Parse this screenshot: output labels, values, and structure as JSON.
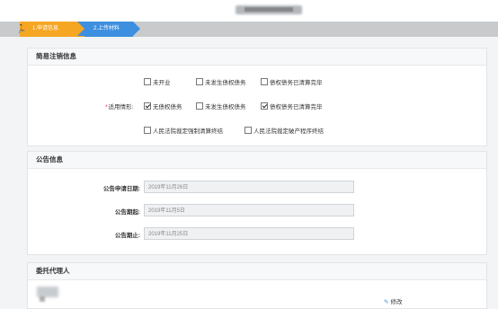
{
  "header": {
    "title_blurred": true
  },
  "steps": {
    "home_glyph": "🏃",
    "step1": "1.申请信息",
    "step2": "2.上传材料"
  },
  "simple_cancel": {
    "title": "简易注销信息",
    "opt_not_opened": "未开业",
    "opt_no_debt": "未发生债权债务",
    "opt_debt_cleared_top": "债权债务已清算完毕",
    "req_label": "适用情形:",
    "opt_no_debt2": "无债权债务",
    "opt_no_debt3": "未发生债权债务",
    "opt_debt_cleared": "债权债务已清算完毕",
    "opt_court_liquidation": "人民法院裁定强制清算终结",
    "opt_court_bankruptcy": "人民法院裁定破产程序终结"
  },
  "notice": {
    "title": "公告信息",
    "apply_date_label": "公告申请日期:",
    "apply_date_value": "2019年11月26日",
    "start_label": "公告期起:",
    "start_value": "2019年11月5日",
    "end_label": "公告期止:",
    "end_value": "2019年11月25日"
  },
  "agent": {
    "title": "委托代理人",
    "edit": "修改"
  },
  "colors": {
    "step1": "#f5a623",
    "step2": "#3d8fdf",
    "required": "#e23333"
  }
}
